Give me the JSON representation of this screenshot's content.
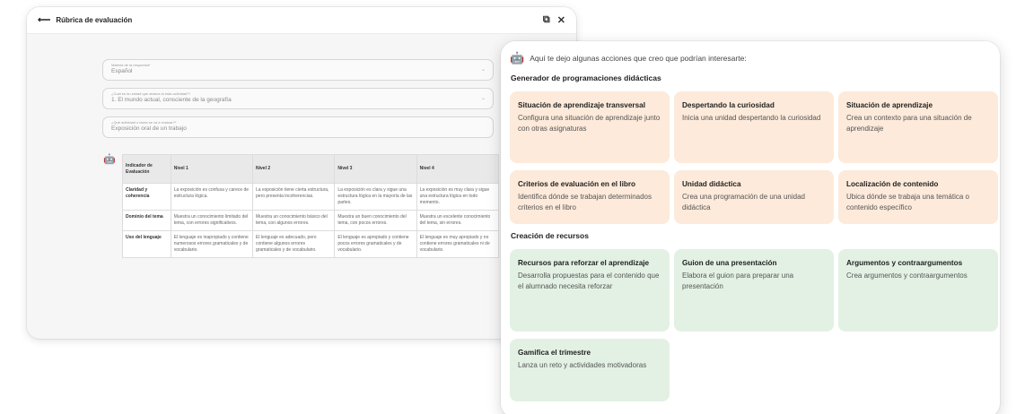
{
  "back_window": {
    "title": "Rúbrica de evaluación",
    "back_icon": "arrow-left-icon",
    "fields": [
      {
        "label": "Materia de la respuesta*",
        "value": "Español"
      },
      {
        "label": "¿Cuál es la unidad que abarca la esta actividad?*",
        "value": "1. El mundo actual, consciente de la geografía"
      },
      {
        "label": "¿Qué actividad o tarea se va a evaluar?*",
        "value": "Exposición oral de un trabajo"
      }
    ],
    "table": {
      "headers": [
        "Indicador de Evaluación",
        "Nivel 1",
        "Nivel 2",
        "Nivel 3",
        "Nivel 4"
      ],
      "rows": [
        [
          "Claridad y coherencia",
          "La exposición es confusa y carece de estructura lógica.",
          "La exposición tiene cierta estructura, pero presenta incoherencias.",
          "La exposición es clara y sigue una estructura lógica en la mayoría de las partes.",
          "La exposición es muy clara y sigue una estructura lógica en todo momento."
        ],
        [
          "Dominio del tema",
          "Muestra un conocimiento limitado del tema, con errores significativos.",
          "Muestra un conocimiento básico del tema, con algunos errores.",
          "Muestra un buen conocimiento del tema, con pocos errores.",
          "Muestra un excelente conocimiento del tema, sin errores."
        ],
        [
          "Uso del lenguaje",
          "El lenguaje es inapropiado y contiene numerosos errores gramaticales y de vocabulario.",
          "El lenguaje es adecuado, pero contiene algunos errores gramaticales y de vocabulario.",
          "El lenguaje es apropiado y contiene pocos errores gramaticales y de vocabulario.",
          "El lenguaje es muy apropiado y no contiene errores gramaticales ni de vocabulario."
        ]
      ]
    }
  },
  "panel": {
    "intro": "Aquí te dejo algunas acciones que creo que podrían interesarte:",
    "sections": [
      {
        "title": "Generador de programaciones didácticas",
        "color": "#fdeada",
        "cards": [
          {
            "title": "Situación de aprendizaje transversal",
            "desc": "Configura una situación de aprendizaje junto con otras asignaturas"
          },
          {
            "title": "Despertando la curiosidad",
            "desc": "Inicia una unidad despertando la curiosidad"
          },
          {
            "title": "Situación de aprendizaje",
            "desc": "Crea un contexto para una situación de aprendizaje"
          },
          {
            "title": "Criterios de evaluación en el libro",
            "desc": "Identifica dónde se trabajan determinados criterios en el libro"
          },
          {
            "title": "Unidad didáctica",
            "desc": "Crea una programación de una unidad didáctica"
          },
          {
            "title": "Localización de contenido",
            "desc": "Ubica dónde se trabaja una temática o contenido específico"
          }
        ]
      },
      {
        "title": "Creación de recursos",
        "color": "#e3f1e4",
        "cards": [
          {
            "title": "Recursos para reforzar el aprendizaje",
            "desc": "Desarrolla propuestas para el contenido que el alumnado necesita reforzar"
          },
          {
            "title": "Guion de una presentación",
            "desc": "Elabora el guion para preparar una presentación"
          },
          {
            "title": "Argumentos y contraargumentos",
            "desc": "Crea argumentos y contraargumentos"
          },
          {
            "title": "Gamifica el trimestre",
            "desc": "Lanza un reto y actividades motivadoras"
          }
        ]
      }
    ]
  }
}
